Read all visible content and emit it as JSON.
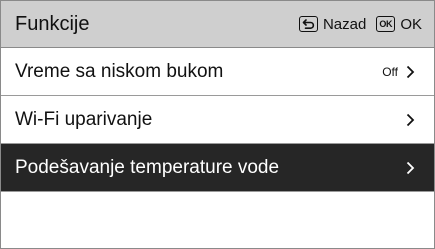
{
  "header": {
    "title": "Funkcije",
    "back_label": "Nazad",
    "ok_key": "OK",
    "ok_label": "OK"
  },
  "menu": {
    "items": [
      {
        "label": "Vreme sa niskom bukom",
        "value": "Off",
        "selected": false
      },
      {
        "label": "Wi-Fi uparivanje",
        "value": "",
        "selected": false
      },
      {
        "label": "Podešavanje temperature vode",
        "value": "",
        "selected": true
      }
    ]
  },
  "icons": {
    "back": "back-arrow-icon",
    "ok": "ok-key-icon",
    "chevron": "chevron-right-icon"
  },
  "colors": {
    "header_bg": "#cfcfcf",
    "selected_bg": "#262626",
    "divider": "#9a9a9a"
  }
}
